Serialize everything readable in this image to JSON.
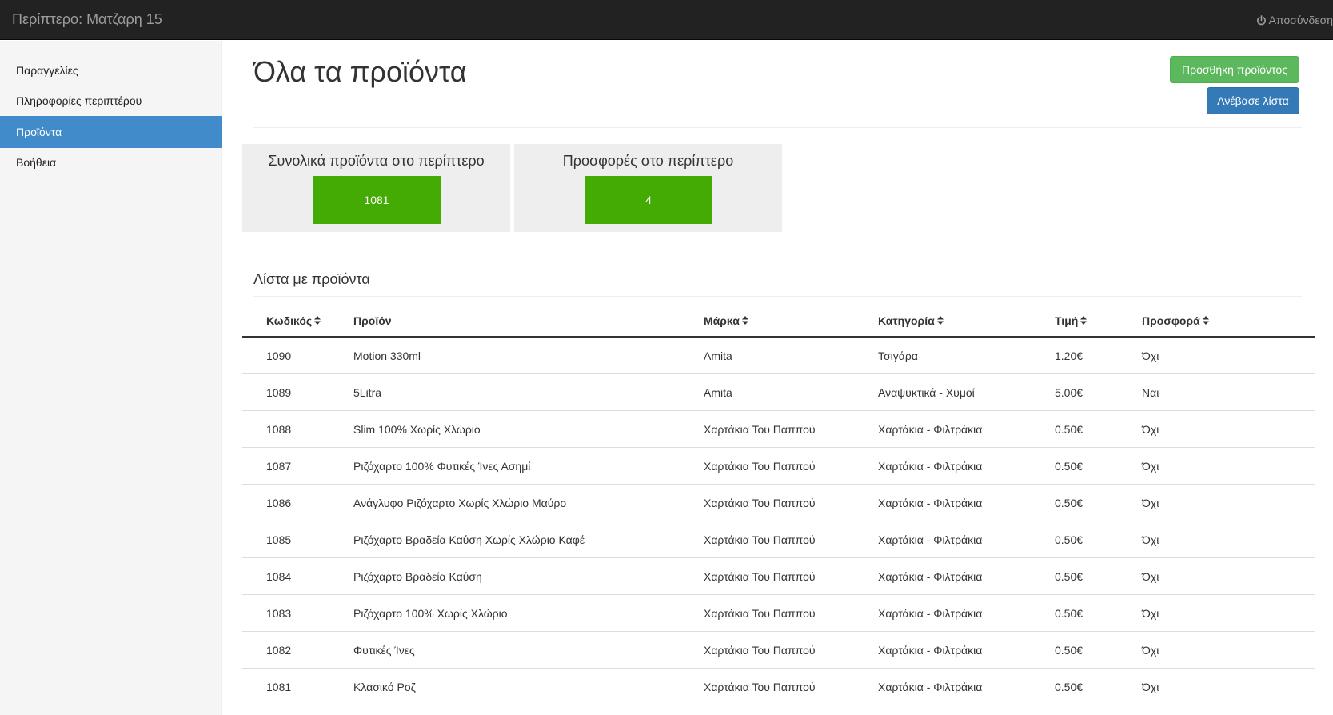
{
  "navbar": {
    "brand": "Περίπτερο: Ματζαρη 15",
    "logout_icon": "power-icon",
    "logout_label": "Αποσύνδεση"
  },
  "sidebar": {
    "items": [
      {
        "label": "Παραγγελίες",
        "active": false
      },
      {
        "label": "Πληροφορίες περιπτέρου",
        "active": false
      },
      {
        "label": "Προϊόντα",
        "active": true
      },
      {
        "label": "Βοήθεια",
        "active": false
      }
    ]
  },
  "header": {
    "title": "Όλα τα προϊόντα",
    "add_product_label": "Προσθήκη προϊόντος",
    "upload_list_label": "Ανέβασε λίστα"
  },
  "stats": {
    "total_title": "Συνολικά προϊόντα στο περίπτερο",
    "total_value": "1081",
    "offers_title": "Προσφορές στο περίπτερο",
    "offers_value": "4"
  },
  "list": {
    "heading": "Λίστα με προϊόντα",
    "columns": [
      "Κωδικός",
      "Προϊόν",
      "Μάρκα",
      "Κατηγορία",
      "Τιμή",
      "Προσφορά"
    ],
    "rows": [
      [
        "1090",
        "Motion 330ml",
        "Amita",
        "Τσιγάρα",
        "1.20€",
        "Όχι"
      ],
      [
        "1089",
        "5Litra",
        "Amita",
        "Αναψυκτικά - Χυμοί",
        "5.00€",
        "Ναι"
      ],
      [
        "1088",
        "Slim 100% Χωρίς Χλώριο",
        "Χαρτάκια Του Παππού",
        "Χαρτάκια - Φιλτράκια",
        "0.50€",
        "Όχι"
      ],
      [
        "1087",
        "Ριζόχαρτο 100% Φυτικές Ίνες Ασημί",
        "Χαρτάκια Του Παππού",
        "Χαρτάκια - Φιλτράκια",
        "0.50€",
        "Όχι"
      ],
      [
        "1086",
        "Ανάγλυφο Ριζόχαρτο Χωρίς Χλώριο Μαύρο",
        "Χαρτάκια Του Παππού",
        "Χαρτάκια - Φιλτράκια",
        "0.50€",
        "Όχι"
      ],
      [
        "1085",
        "Ριζόχαρτο Βραδεία Καύση Χωρίς Χλώριο Καφέ",
        "Χαρτάκια Του Παππού",
        "Χαρτάκια - Φιλτράκια",
        "0.50€",
        "Όχι"
      ],
      [
        "1084",
        "Ριζόχαρτο Βραδεία Καύση",
        "Χαρτάκια Του Παππού",
        "Χαρτάκια - Φιλτράκια",
        "0.50€",
        "Όχι"
      ],
      [
        "1083",
        "Ριζόχαρτο 100% Χωρίς Χλώριο",
        "Χαρτάκια Του Παππού",
        "Χαρτάκια - Φιλτράκια",
        "0.50€",
        "Όχι"
      ],
      [
        "1082",
        "Φυτικές Ίνες",
        "Χαρτάκια Του Παππού",
        "Χαρτάκια - Φιλτράκια",
        "0.50€",
        "Όχι"
      ],
      [
        "1081",
        "Κλασικό Ροζ",
        "Χαρτάκια Του Παππού",
        "Χαρτάκια - Φιλτράκια",
        "0.50€",
        "Όχι"
      ]
    ]
  },
  "colors": {
    "navbar_bg": "#222222",
    "sidebar_active": "#428bca",
    "success_button": "#5cb85c",
    "primary_button": "#337ab7",
    "stat_value_bg": "#44ab04"
  }
}
